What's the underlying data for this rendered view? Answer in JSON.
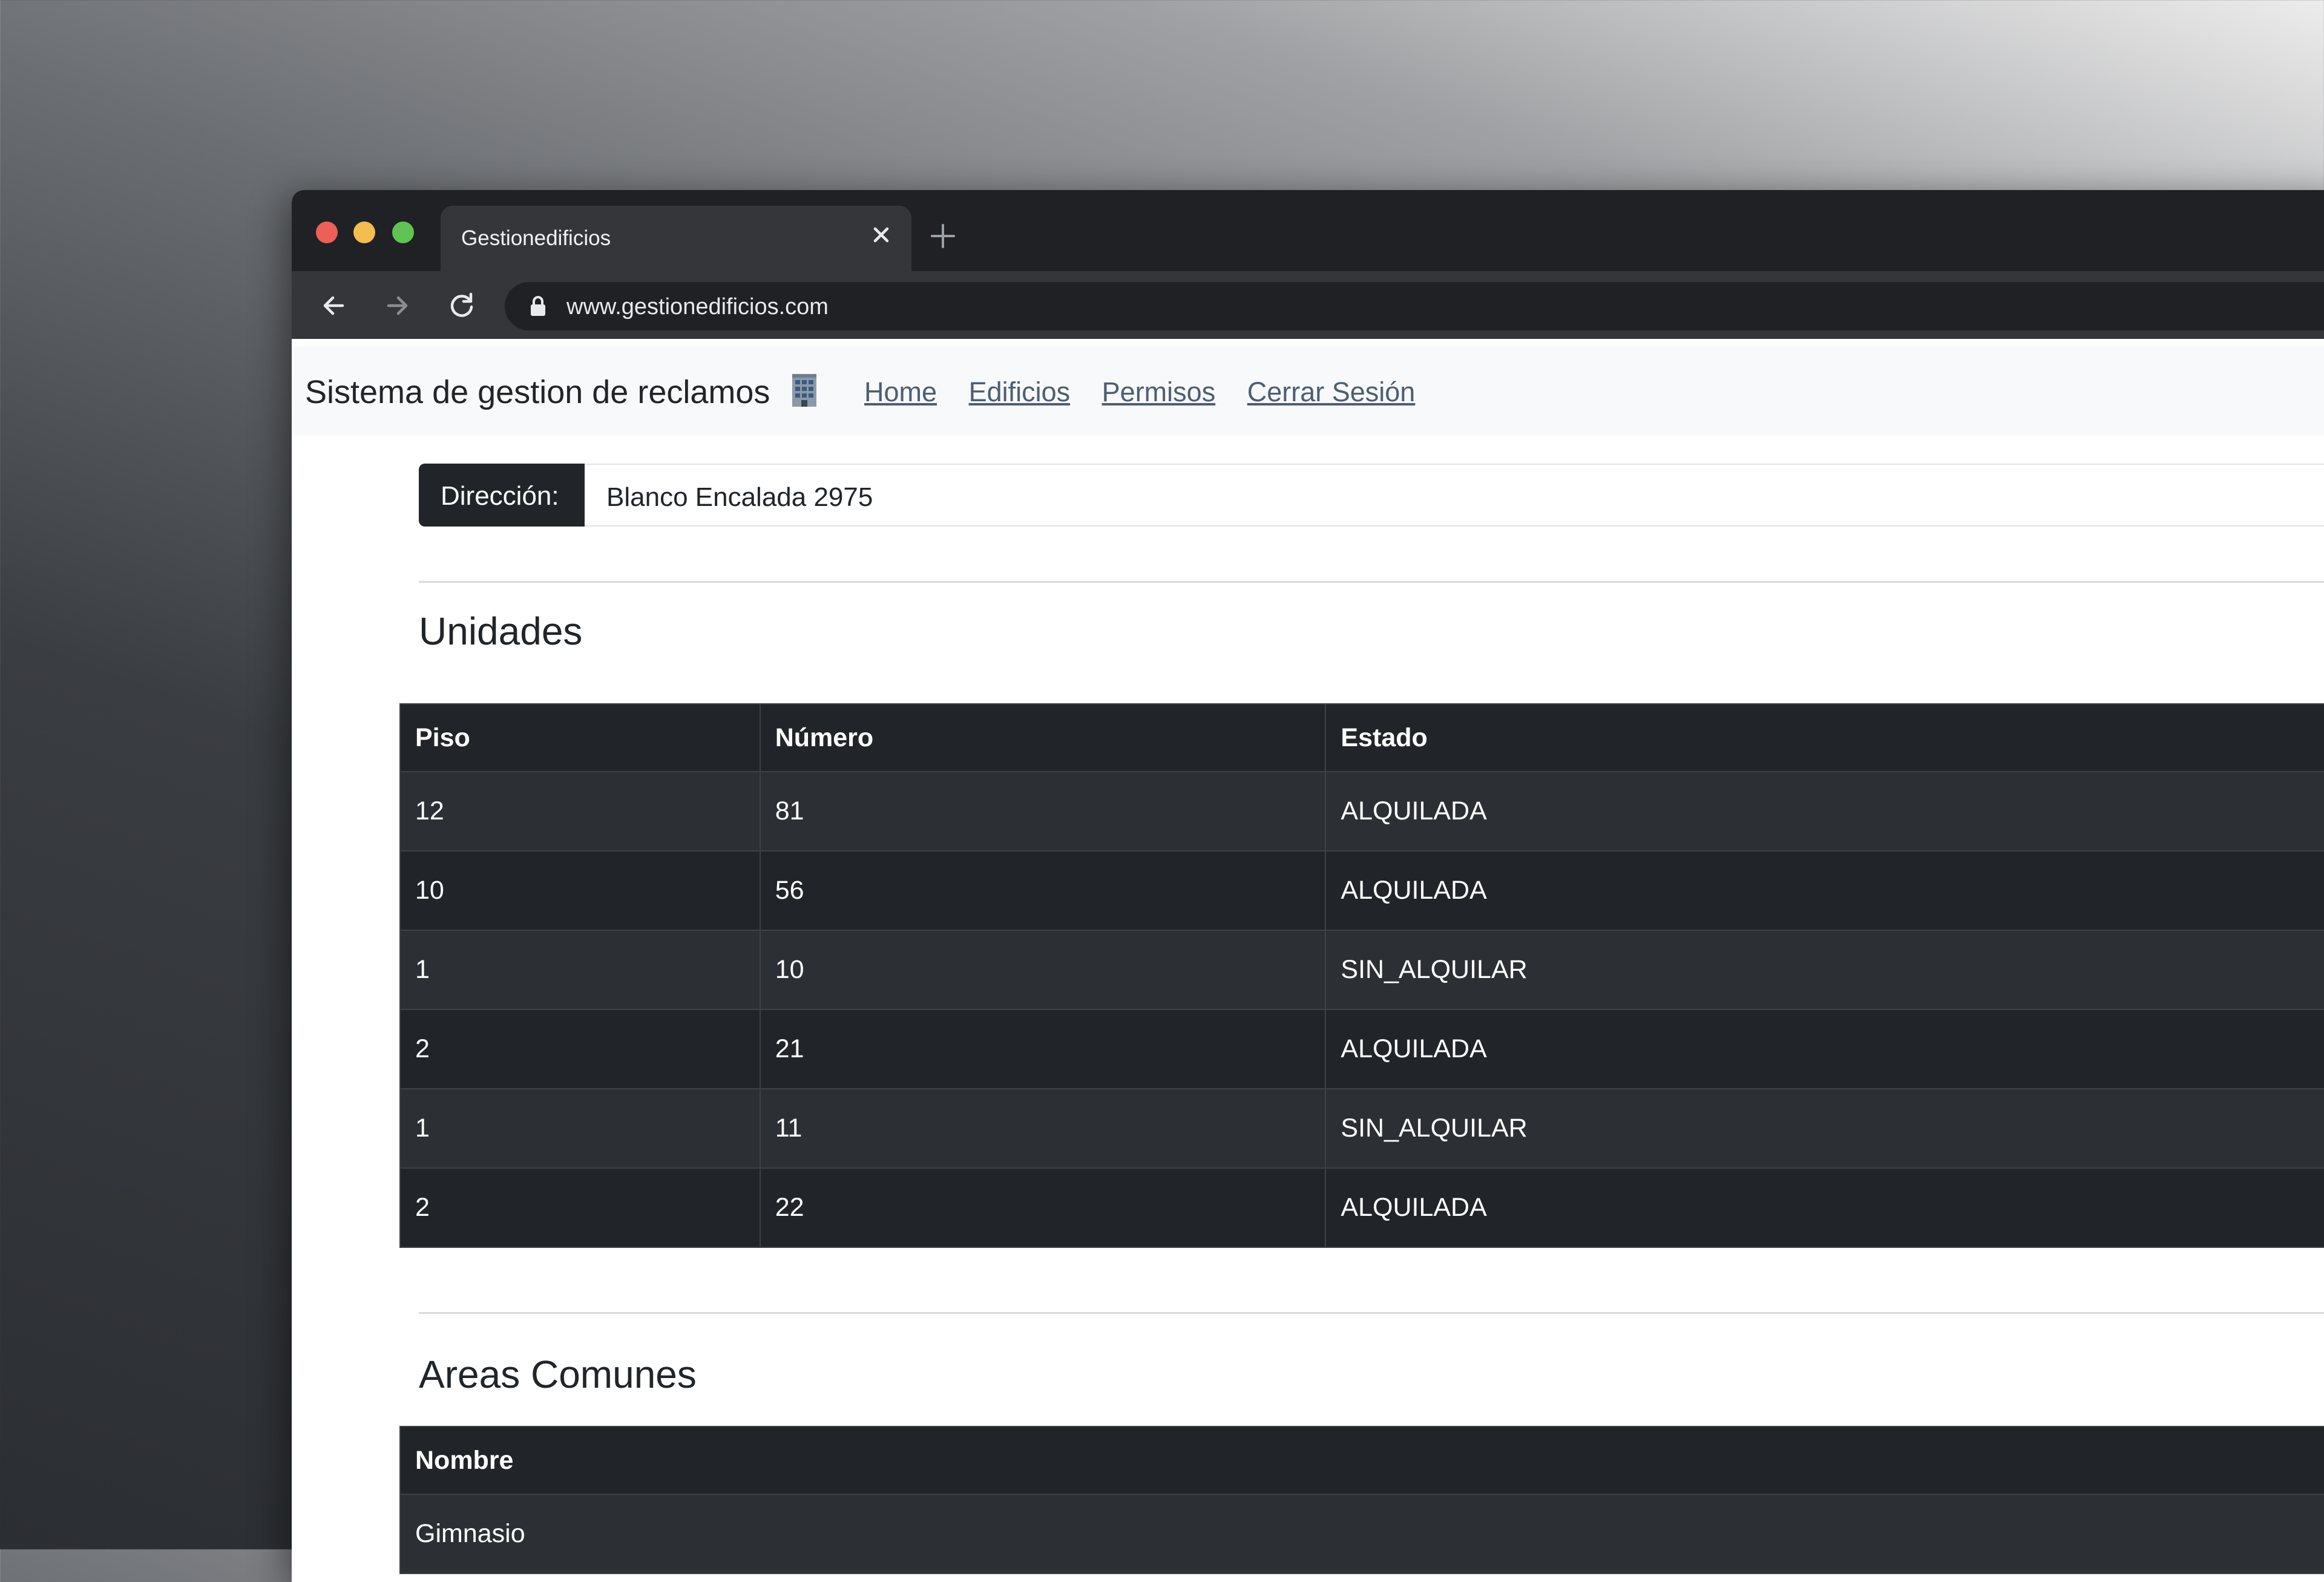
{
  "browser": {
    "tab_title": "Gestionedificios",
    "url": "www.gestionedificios.com"
  },
  "navbar": {
    "brand": "Sistema de gestion de reclamos",
    "brand_icon": "office-building-icon",
    "links": [
      "Home",
      "Edificios",
      "Permisos",
      "Cerrar Sesión"
    ]
  },
  "direccion": {
    "label": "Dirección:",
    "value": "Blanco Encalada 2975"
  },
  "unidades": {
    "title": "Unidades",
    "columns": [
      "Piso",
      "Número",
      "Estado"
    ],
    "rows": [
      [
        "12",
        "81",
        "ALQUILADA"
      ],
      [
        "10",
        "56",
        "ALQUILADA"
      ],
      [
        "1",
        "10",
        "SIN_ALQUILAR"
      ],
      [
        "2",
        "21",
        "ALQUILADA"
      ],
      [
        "1",
        "11",
        "SIN_ALQUILAR"
      ],
      [
        "2",
        "22",
        "ALQUILADA"
      ]
    ]
  },
  "areas": {
    "title": "Areas Comunes",
    "columns": [
      "Nombre"
    ],
    "rows": [
      [
        "Gimnasio"
      ]
    ]
  }
}
